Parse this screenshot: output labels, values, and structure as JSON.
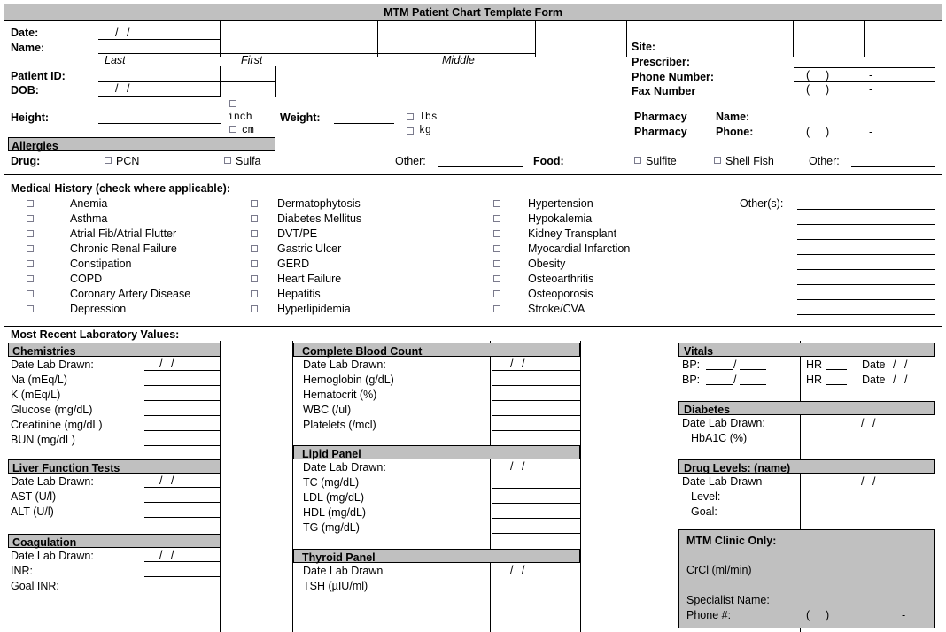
{
  "document": {
    "title": "MTM Patient Chart Template Form"
  },
  "patient": {
    "date_label": "Date:",
    "date_value": "/  /",
    "name_label": "Name:",
    "name_last_hint": "Last",
    "name_first_hint": "First",
    "name_middle_hint": "Middle",
    "patient_id_label": "Patient ID:",
    "dob_label": "DOB:",
    "dob_value": "/  /",
    "height_label": "Height:",
    "height_unit_inch": "inch",
    "height_unit_cm": "cm",
    "weight_label": "Weight:",
    "weight_unit_lbs": "lbs",
    "weight_unit_kg": "kg"
  },
  "provider": {
    "site_label": "Site:",
    "prescriber_label": "Prescriber:",
    "phone_label": "Phone Number:",
    "fax_label": "Fax Number",
    "phone_paren_open": "(",
    "phone_paren_close": ")",
    "phone_dash": "-",
    "pharmacy_word_1": "Pharmacy",
    "pharmacy_word_2": "Pharmacy",
    "pharmacy_name_label": "Name:",
    "pharmacy_phone_label": "Phone:"
  },
  "allergies": {
    "section_title": "Allergies",
    "drug_label": "Drug:",
    "drug_options": [
      "PCN",
      "Sulfa"
    ],
    "drug_other_label": "Other:",
    "food_label": "Food:",
    "food_options": [
      "Sulfite",
      "Shell Fish"
    ],
    "food_other_label": "Other:"
  },
  "medical_history": {
    "title": "Medical History (check where applicable):",
    "column_1": [
      "Anemia",
      "Asthma",
      "Atrial Fib/Atrial Flutter",
      "Chronic Renal Failure",
      "Constipation",
      "COPD",
      "Coronary Artery Disease",
      "Depression"
    ],
    "column_2": [
      "Dermatophytosis",
      "Diabetes Mellitus",
      "DVT/PE",
      "Gastric Ulcer",
      "GERD",
      "Heart Failure",
      "Hepatitis",
      "Hyperlipidemia"
    ],
    "column_3": [
      "Hypertension",
      "Hypokalemia",
      "Kidney Transplant",
      "Myocardial Infarction",
      "Obesity",
      "Osteoarthritis",
      "Osteoporosis",
      "Stroke/CVA"
    ],
    "others_label": "Other(s):",
    "others_line_count": 8
  },
  "labs": {
    "section_title": "Most Recent Laboratory Values:",
    "date_value": "/  /",
    "chemistries": {
      "title": "Chemistries",
      "rows": [
        "Date Lab Drawn:",
        "Na (mEq/L)",
        "K (mEq/L)",
        "Glucose (mg/dL)",
        "Creatinine (mg/dL)",
        "BUN (mg/dL)"
      ]
    },
    "liver_function": {
      "title": "Liver Function Tests",
      "rows": [
        "Date Lab Drawn:",
        "AST (U/l)",
        "ALT (U/l)"
      ]
    },
    "coagulation": {
      "title": "Coagulation",
      "rows": [
        "Date Lab Drawn:",
        "INR:",
        "Goal INR:"
      ]
    },
    "cbc": {
      "title": "Complete Blood Count",
      "rows": [
        "Date Lab Drawn:",
        "Hemoglobin (g/dL)",
        "Hematocrit (%)",
        "WBC (/ul)",
        "Platelets (/mcl)"
      ]
    },
    "lipid": {
      "title": "Lipid Panel",
      "rows": [
        "Date Lab Drawn:",
        "TC (mg/dL)",
        "LDL (mg/dL)",
        "HDL (mg/dL)",
        "TG (mg/dL)"
      ]
    },
    "thyroid": {
      "title": "Thyroid Panel",
      "rows": [
        "Date Lab Drawn",
        "TSH (µIU/ml)"
      ]
    }
  },
  "vitals": {
    "title": "Vitals",
    "bp_label": "BP:",
    "bp_separator": "/",
    "hr_label": "HR",
    "date_label": "Date",
    "date_value": "/  /",
    "row_count": 2
  },
  "diabetes": {
    "title": "Diabetes",
    "rows": [
      "Date Lab Drawn:",
      "HbA1C (%)"
    ],
    "date_value": "/  /"
  },
  "drug_levels": {
    "title": "Drug Levels: (name)",
    "rows": [
      "Date Lab Drawn",
      "Level:",
      "Goal:"
    ],
    "date_value": "/  /"
  },
  "mtm_clinic": {
    "title": "MTM Clinic Only:",
    "crcl_label": "CrCl (ml/min)",
    "specialist_label": "Specialist Name:",
    "phone_label": "Phone #:",
    "phone_paren_open": "(",
    "phone_paren_close": ")",
    "phone_dash": "-"
  },
  "colors": {
    "band_gray": "#c0c0c0",
    "border": "#000000",
    "checkbox_border": "#7a7a8c"
  }
}
